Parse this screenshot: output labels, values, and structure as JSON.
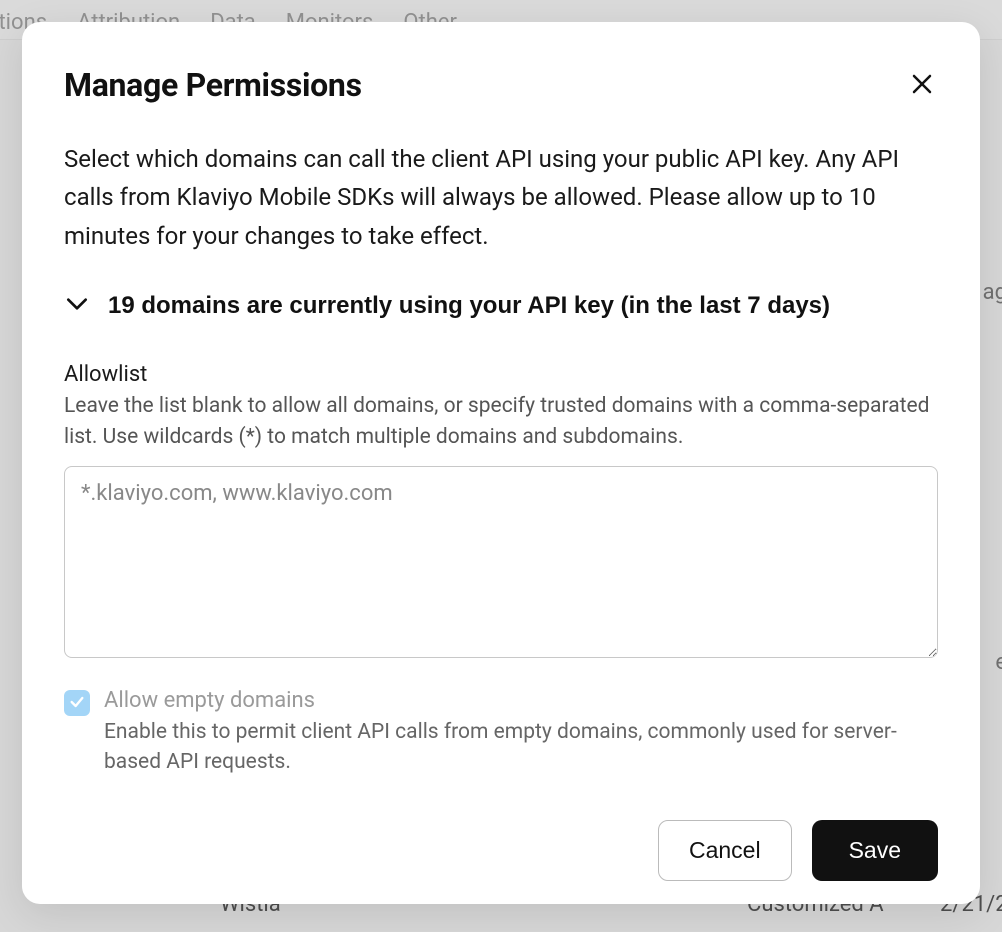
{
  "background": {
    "nav_items": [
      "cations",
      "Attribution",
      "Data",
      "Monitors",
      "Other"
    ],
    "right_snip": "ag",
    "right_snip2": "e",
    "bottom_col1": "Wistia",
    "bottom_col2": "Customized A",
    "bottom_col3": "2/21/2"
  },
  "modal": {
    "title": "Manage Permissions",
    "description": "Select which domains can call the client API using your public API key. Any API calls from Klaviyo Mobile SDKs will always be allowed. Please allow up to 10 minutes for your changes to take effect.",
    "expander_label": "19 domains are currently using your API key (in the last 7 days)",
    "allowlist": {
      "label": "Allowlist",
      "hint": "Leave the list blank to allow all domains, or specify trusted domains with a comma-separated list. Use wildcards (*) to match multiple domains and subdomains.",
      "placeholder": "*.klaviyo.com, www.klaviyo.com",
      "value": ""
    },
    "allow_empty": {
      "checked": true,
      "label": "Allow empty domains",
      "hint": "Enable this to permit client API calls from empty domains, commonly used for server-based API requests."
    },
    "buttons": {
      "cancel": "Cancel",
      "save": "Save"
    }
  }
}
